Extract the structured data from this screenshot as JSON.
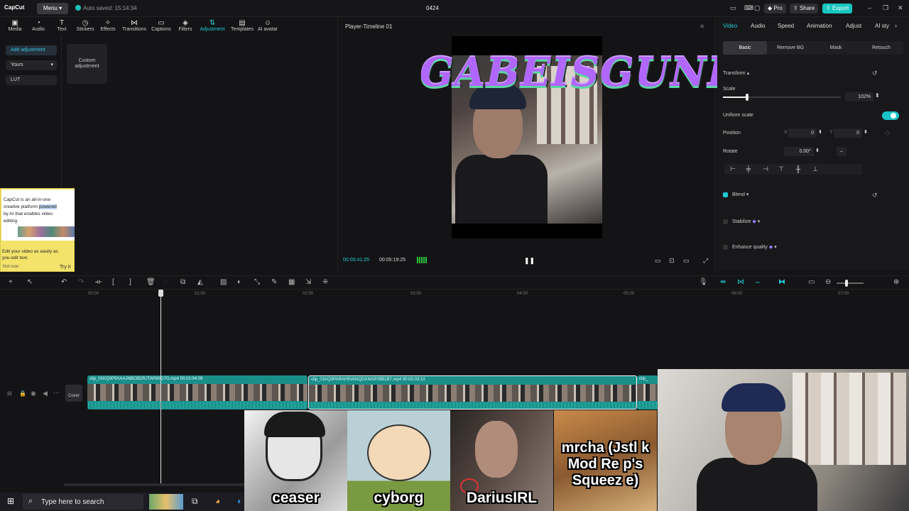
{
  "titlebar": {
    "app_name": "CapCut",
    "menu_label": "Menu",
    "autosave": "Auto saved: 15:14:34",
    "project_title": "0424",
    "pro_label": "Pro",
    "share_label": "Share",
    "export_label": "Export"
  },
  "toolbar": {
    "items": [
      {
        "label": "Media",
        "icon": "media-icon"
      },
      {
        "label": "Audio",
        "icon": "audio-icon"
      },
      {
        "label": "Text",
        "icon": "text-icon"
      },
      {
        "label": "Stickers",
        "icon": "stickers-icon"
      },
      {
        "label": "Effects",
        "icon": "effects-icon"
      },
      {
        "label": "Transitions",
        "icon": "transitions-icon"
      },
      {
        "label": "Captions",
        "icon": "captions-icon"
      },
      {
        "label": "Filters",
        "icon": "filters-icon"
      },
      {
        "label": "Adjustment",
        "icon": "adjustment-icon",
        "active": true
      },
      {
        "label": "Templates",
        "icon": "templates-icon"
      },
      {
        "label": "AI avatar",
        "icon": "ai-avatar-icon"
      }
    ]
  },
  "left_panel": {
    "add_adjustment": "Add adjustment",
    "yours": "Yours",
    "lut": "LUT",
    "custom_card": "Custom adjustment"
  },
  "promo": {
    "line1": "CapCut is an all-in-one",
    "line2": "creative platform powered",
    "line3": "by AI that enables video",
    "line4": "editing",
    "body1": "Edit your video as easily as",
    "body2": "you edit text.",
    "not_now": "Not now",
    "try_it": "Try it"
  },
  "player": {
    "title": "Player-Timeline 01",
    "overlay_text": "GABEISGUNK",
    "current_time": "00:00:41:25",
    "duration": "00:05:19:25"
  },
  "inspector": {
    "tabs": [
      "Video",
      "Audio",
      "Speed",
      "Animation",
      "Adjust",
      "AI sty"
    ],
    "subtabs": [
      "Basic",
      "Remove BG",
      "Mask",
      "Retouch"
    ],
    "transform_label": "Transform",
    "scale_label": "Scale",
    "scale_value": "102%",
    "scale_fraction": 0.2,
    "uniform_scale_label": "Uniform scale",
    "position_label": "Position",
    "pos_x_label": "X",
    "pos_x": "0",
    "pos_y_label": "Y",
    "pos_y": "0",
    "rotate_label": "Rotate",
    "rotate_value": "0.00°",
    "rotate_dash": "–",
    "blend_label": "Blend",
    "stabilize_label": "Stabilize",
    "enhance_label": "Enhance quality"
  },
  "timeline": {
    "ruler": [
      "00:00",
      "01:00",
      "02:00",
      "03:00",
      "04:00",
      "05:00",
      "06:00",
      "07:00"
    ],
    "cover_label": "Cover",
    "clips": [
      {
        "label": "clip_01KQ0P9XAAJNBCBDRJTAR89G7G.mp4   00:02:04:09"
      },
      {
        "label": "clip_01KQ0PARAH5VANQDXNA9YBB1B7.mp4   00:03:03:10"
      },
      {
        "label": "clip_"
      }
    ]
  },
  "chat_cards": [
    {
      "name": "ceaser"
    },
    {
      "name": "cyborg"
    },
    {
      "name": "DariusIRL"
    },
    {
      "name": "mrcha (Jstl k Mod Re p's Squeez e)"
    }
  ],
  "taskbar": {
    "search_placeholder": "Type here to search"
  },
  "colors": {
    "accent": "#1fc8d6",
    "export": "#18c6c0",
    "clip": "#1a8f8a"
  }
}
